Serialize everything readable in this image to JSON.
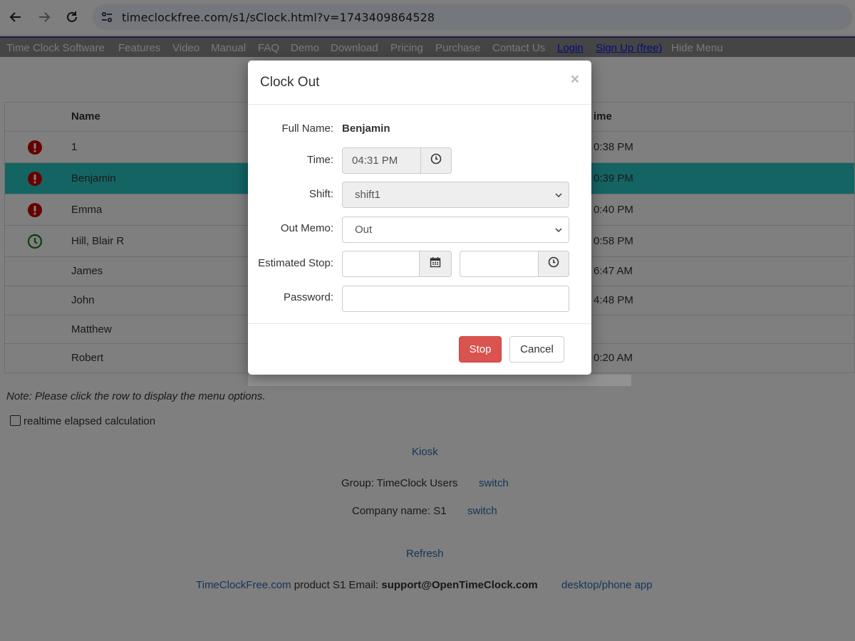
{
  "browser": {
    "url": "timeclockfree.com/s1/sClock.html?v=1743409864528"
  },
  "menu": {
    "items": [
      "Time Clock Software",
      "Features",
      "Video",
      "Manual",
      "FAQ",
      "Demo",
      "Download",
      "Pricing",
      "Purchase",
      "Contact Us"
    ],
    "login": "Login",
    "signup": "Sign Up (free)",
    "hide": "Hide Menu"
  },
  "table": {
    "headers": {
      "name": "Name",
      "time": "ime"
    },
    "rows": [
      {
        "name": "1",
        "time": "0:38 PM",
        "status": "alert-icon"
      },
      {
        "name": "Benjamin",
        "time": "0:39 PM",
        "status": "alert-icon"
      },
      {
        "name": "Emma",
        "time": "0:40 PM",
        "status": "alert-icon"
      },
      {
        "name": "Hill, Blair R",
        "time": "0:58 PM",
        "status": "clock-icon"
      },
      {
        "name": "James",
        "time": "6:47 AM",
        "status": ""
      },
      {
        "name": "John",
        "time": "4:48 PM",
        "status": ""
      },
      {
        "name": "Matthew",
        "time": "",
        "status": ""
      },
      {
        "name": "Robert",
        "time": "0:20 AM",
        "status": ""
      }
    ]
  },
  "note": "Note: Please click the row to display the menu options.",
  "realtime_label": "realtime elapsed calculation",
  "kiosk": "Kiosk",
  "group_label": "Group: TimeClock Users",
  "company_label": "Company name: S1",
  "switch": "switch",
  "refresh": "Refresh",
  "footer": {
    "site_link": "TimeClockFree.com",
    "product": " product S1 Email: ",
    "email": "support@OpenTimeClock.com",
    "app_link": "desktop/phone app"
  },
  "modal": {
    "title": "Clock Out",
    "close": "×",
    "full_name_label": "Full Name:",
    "full_name": "Benjamin",
    "time_label": "Time:",
    "time_value": "04:31 PM",
    "shift_label": "Shift:",
    "shift_value": "shift1",
    "out_memo_label": "Out Memo:",
    "out_memo_value": "Out",
    "estimated_stop_label": "Estimated Stop:",
    "estimated_date_value": "",
    "estimated_time_value": "",
    "password_label": "Password:",
    "password_value": "",
    "stop_label": "Stop",
    "cancel_label": "Cancel"
  },
  "colors": {
    "selected_row": "#2bc9c9",
    "alert": "#cc0000",
    "clock": "#1a7a1a",
    "stop_button": "#d9534f",
    "link": "#2a6cb0"
  }
}
